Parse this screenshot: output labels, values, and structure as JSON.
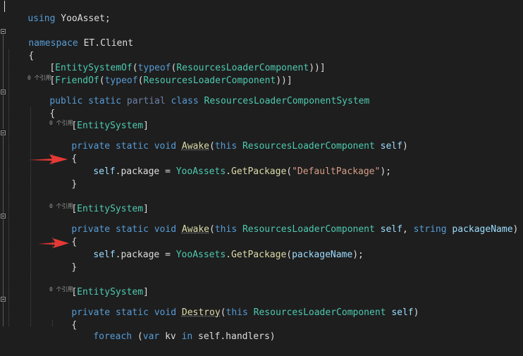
{
  "editor": {
    "lines": {
      "l1": {
        "kw": "using",
        "ns": "YooAsset",
        "end": ";"
      },
      "l2": {
        "kw": "namespace",
        "ns": "ET.Client"
      },
      "l3": {
        "brace": "{"
      },
      "l4": {
        "open": "[",
        "attr": "EntitySystemOf",
        "p1": "(",
        "kw": "typeof",
        "p2": "(",
        "type": "ResourcesLoaderComponent",
        "close": "))]"
      },
      "l5": {
        "open": "[",
        "attr": "FriendOf",
        "p1": "(",
        "kw": "typeof",
        "p2": "(",
        "type": "ResourcesLoaderComponent",
        "close": "))]"
      },
      "l6_ref": "0 个引用",
      "l7": {
        "kw1": "public",
        "kw2": "static",
        "partial": "partial",
        "kw3": "class",
        "cls": "ResourcesLoaderComponentSystem"
      },
      "l8": {
        "brace": "{"
      },
      "m1_attr": {
        "open": "[",
        "name": "EntitySystem",
        "close": "]"
      },
      "m1_ref": "0 个引用",
      "m1_sig": {
        "kw1": "private",
        "kw2": "static",
        "kw3": "void",
        "fn": "Awake",
        "p1": "(",
        "kw4": "this",
        "type": "ResourcesLoaderComponent",
        "param": "self",
        "p2": ")"
      },
      "m1_open": "{",
      "m1_body": {
        "self": "self",
        "member": ".package = ",
        "cls": "YooAssets",
        "dot": ".",
        "fn": "GetPackage",
        "p1": "(",
        "str": "\"DefaultPackage\"",
        "p2": ");"
      },
      "m1_close": "}",
      "m2_attr": {
        "open": "[",
        "name": "EntitySystem",
        "close": "]"
      },
      "m2_ref": "0 个引用",
      "m2_sig": {
        "kw1": "private",
        "kw2": "static",
        "kw3": "void",
        "fn": "Awake",
        "p1": "(",
        "kw4": "this",
        "type": "ResourcesLoaderComponent",
        "param": "self",
        "comma": ", ",
        "kw5": "string",
        "param2": "packageName",
        "p2": ")"
      },
      "m2_open": "{",
      "m2_body": {
        "self": "self",
        "member": ".package = ",
        "cls": "YooAssets",
        "dot": ".",
        "fn": "GetPackage",
        "p1": "(",
        "arg": "packageName",
        "p2": ");"
      },
      "m2_close": "}",
      "m3_attr": {
        "open": "[",
        "name": "EntitySystem",
        "close": "]"
      },
      "m3_ref": "0 个引用",
      "m3_sig": {
        "kw1": "private",
        "kw2": "static",
        "kw3": "void",
        "fn": "Destroy",
        "p1": "(",
        "kw4": "this",
        "type": "ResourcesLoaderComponent",
        "param": "self",
        "p2": ")"
      },
      "m3_open": "{",
      "m3_body": {
        "kw": "foreach",
        "p1": " (",
        "kw2": "var",
        "var": " kv ",
        "kw3": "in",
        "rest": " self.handlers)"
      }
    }
  },
  "colors": {
    "background": "#1e1e1e",
    "keyword": "#569cd6",
    "type": "#4ec9b0",
    "method": "#dcdcaa",
    "string": "#d69d85",
    "parameter": "#9cdcfe",
    "arrow": "#e53935"
  },
  "icons": [
    "collapse-icon",
    "red-arrow-icon"
  ]
}
